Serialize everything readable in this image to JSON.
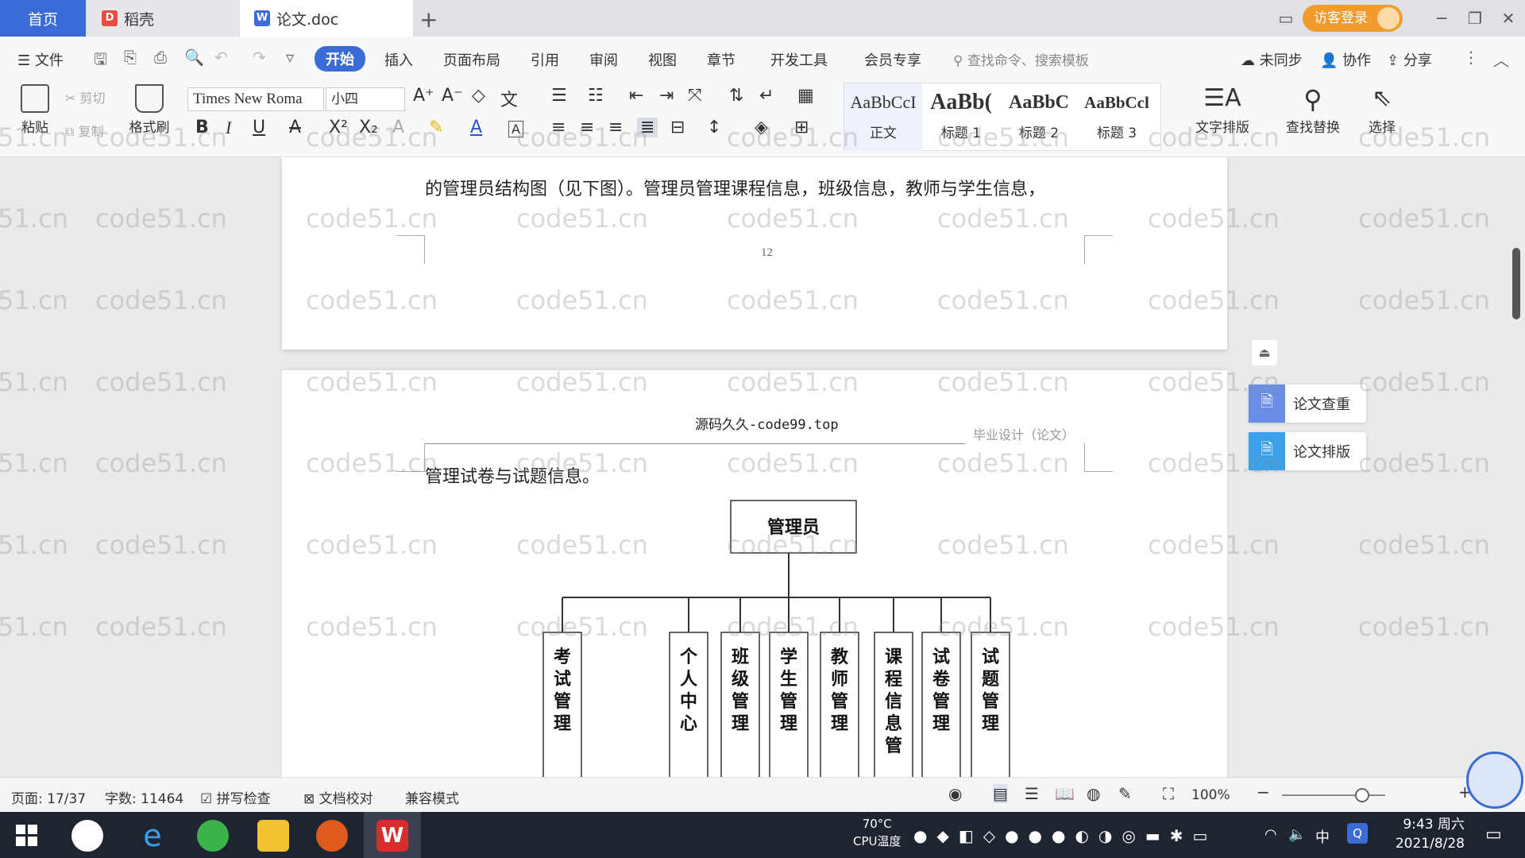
{
  "tabs": {
    "home": "首页",
    "daoke": "稻壳",
    "doc": "论文.doc",
    "add": "+"
  },
  "top_right": {
    "login": "访客登录",
    "minimize": "─",
    "restore": "❐",
    "close": "✕"
  },
  "menu": {
    "file": "文件",
    "items": [
      "开始",
      "插入",
      "页面布局",
      "引用",
      "审阅",
      "视图",
      "章节",
      "开发工具",
      "会员专享"
    ],
    "search": "查找命令、搜索模板",
    "sync": "未同步",
    "collab": "协作",
    "share": "分享"
  },
  "ribbon": {
    "paste": "粘贴",
    "cut": "剪切",
    "copy": "复制",
    "format_painter": "格式刷",
    "font_name": "Times New Roma",
    "font_size": "小四",
    "bold": "B",
    "italic": "I",
    "underline": "U",
    "styles": [
      {
        "sample": "AaBbCcI",
        "name": "正文"
      },
      {
        "sample": "AaBb(",
        "name": "标题 1"
      },
      {
        "sample": "AaBbC",
        "name": "标题 2"
      },
      {
        "sample": "AaBbCcl",
        "name": "标题 3"
      }
    ],
    "text_layout": "文字排版",
    "find_replace": "查找替换",
    "select": "选择"
  },
  "document": {
    "page1_text": "的管理员结构图（见下图）。管理员管理课程信息，班级信息，教师与学生信息，",
    "page1_number": "12",
    "page2_header_center": "源码久久-code99.top",
    "page2_header_right": "毕业设计（论文）",
    "page2_text": "管理试卷与试题信息。",
    "chart_root": "管理员",
    "chart_children": [
      "考试管理",
      "个人中心",
      "班级管理",
      "学生管理",
      "教师管理",
      "课程信息管",
      "试卷管理",
      "试题管理"
    ]
  },
  "side_panel": {
    "check": "论文查重",
    "layout": "论文排版"
  },
  "status": {
    "page": "页面: 17/37",
    "words": "字数: 11464",
    "spell": "拼写检查",
    "proof": "文档校对",
    "compat": "兼容模式",
    "zoom": "100%"
  },
  "taskbar": {
    "temp": "70°C",
    "cpu": "CPU温度",
    "ime": "中",
    "time": "9:43 周六",
    "date": "2021/8/28"
  },
  "watermark": "code51.cn"
}
